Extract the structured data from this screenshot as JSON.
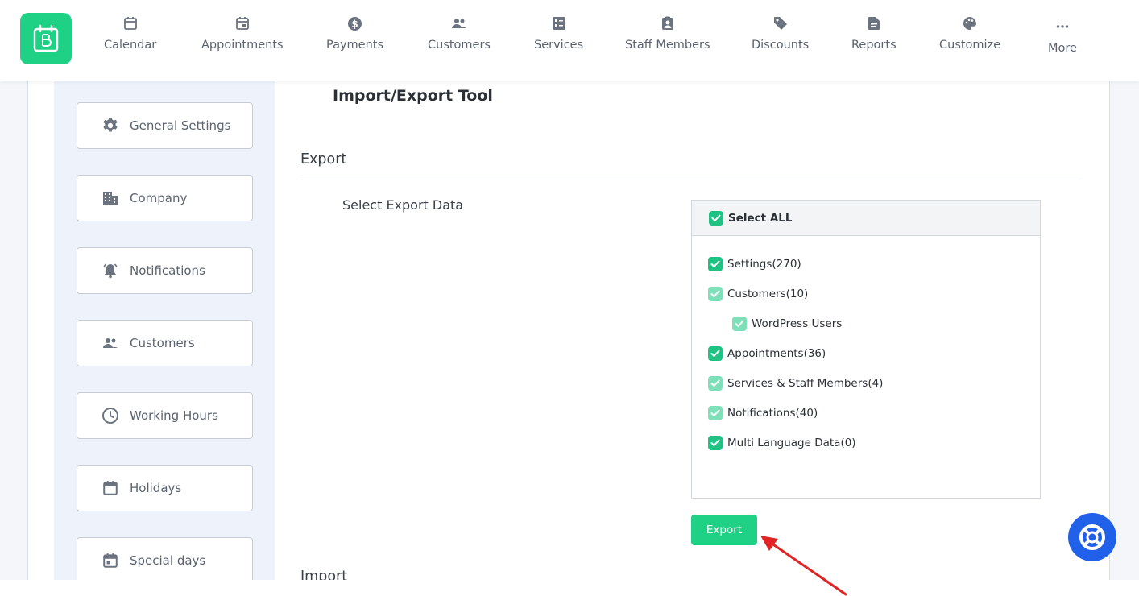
{
  "nav": {
    "items": [
      {
        "label": "Calendar",
        "icon": "calendar-icon"
      },
      {
        "label": "Appointments",
        "icon": "calendar-event-icon"
      },
      {
        "label": "Payments",
        "icon": "dollar-circle-icon"
      },
      {
        "label": "Customers",
        "icon": "users-icon"
      },
      {
        "label": "Services",
        "icon": "services-list-icon"
      },
      {
        "label": "Staff Members",
        "icon": "staff-badge-icon"
      },
      {
        "label": "Discounts",
        "icon": "tag-icon"
      },
      {
        "label": "Reports",
        "icon": "report-file-icon"
      },
      {
        "label": "Customize",
        "icon": "palette-icon"
      },
      {
        "label": "More",
        "icon": "more-dots-icon"
      }
    ]
  },
  "sidebar": {
    "items": [
      {
        "label": "General Settings",
        "icon": "gear-icon"
      },
      {
        "label": "Company",
        "icon": "building-icon"
      },
      {
        "label": "Notifications",
        "icon": "bell-icon"
      },
      {
        "label": "Customers",
        "icon": "users-icon"
      },
      {
        "label": "Working Hours",
        "icon": "clock-icon"
      },
      {
        "label": "Holidays",
        "icon": "calendar-icon"
      },
      {
        "label": "Special days",
        "icon": "calendar-event-icon"
      }
    ]
  },
  "main": {
    "title": "Import/Export Tool",
    "export_heading": "Export",
    "select_label": "Select Export Data",
    "select_all": "Select ALL",
    "options": [
      {
        "label": "Settings(270)",
        "checked": true,
        "style": "dark"
      },
      {
        "label": "Customers(10)",
        "checked": true,
        "style": "light"
      },
      {
        "label": "WordPress Users",
        "checked": true,
        "style": "light"
      },
      {
        "label": "Appointments(36)",
        "checked": true,
        "style": "dark"
      },
      {
        "label": "Services & Staff Members(4)",
        "checked": true,
        "style": "light"
      },
      {
        "label": "Notifications(40)",
        "checked": true,
        "style": "light"
      },
      {
        "label": "Multi Language Data(0)",
        "checked": true,
        "style": "dark"
      }
    ],
    "export_button": "Export",
    "import_heading": "Import"
  },
  "colors": {
    "brand_green": "#1fd185",
    "check_dark": "#1fc283",
    "check_light": "#7ee0b8",
    "help_blue": "#2160e8",
    "arrow_red": "#e02424"
  }
}
